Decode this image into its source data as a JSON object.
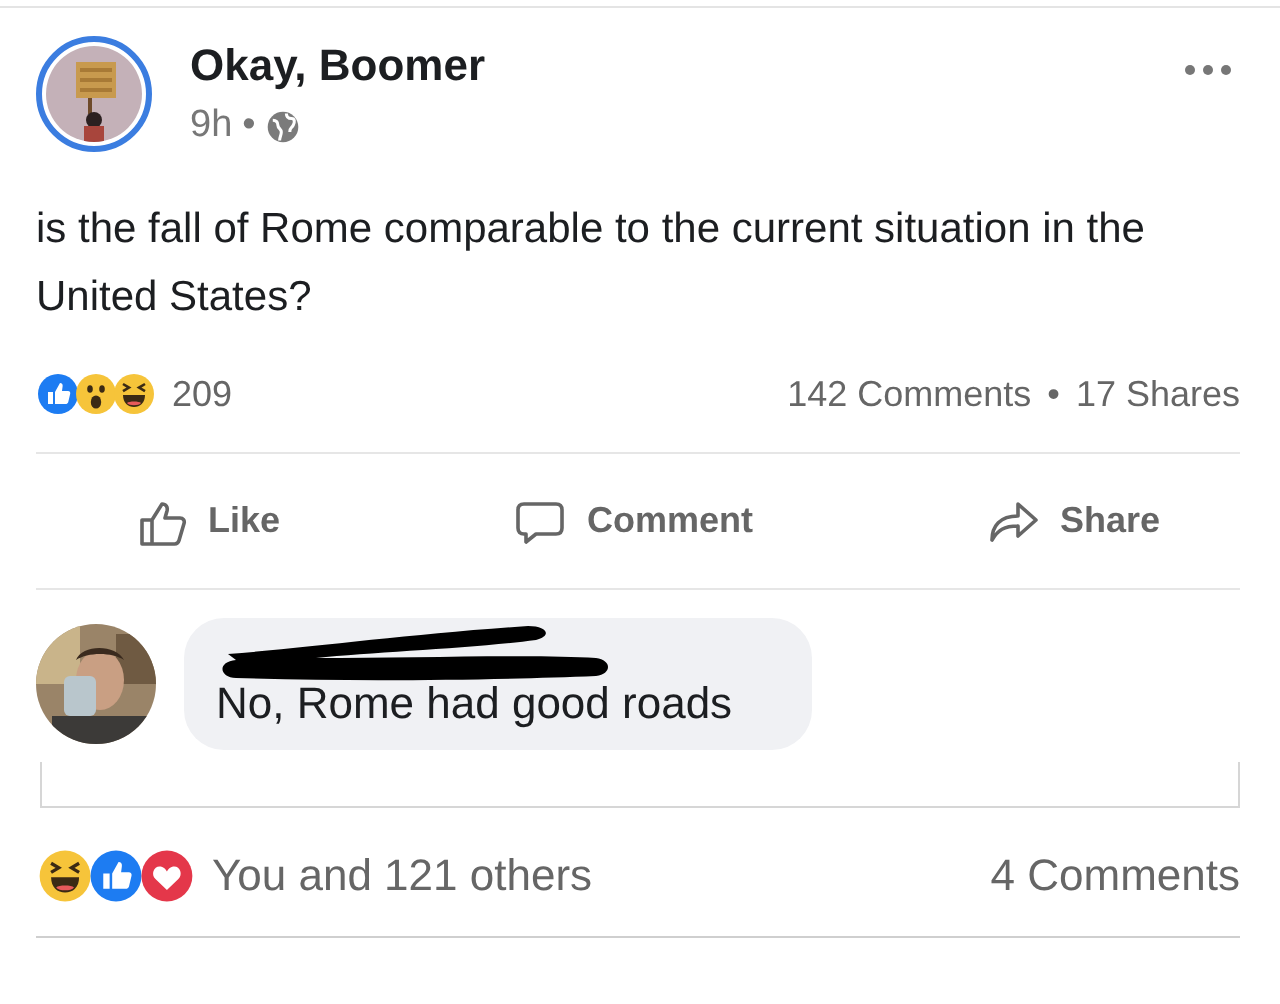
{
  "post": {
    "author": "Okay, Boomer",
    "time": "9h",
    "separator": "•",
    "text": "is the fall of Rome comparable to the current situation in the United States?",
    "reactions_count": "209",
    "comments_count": "142 Comments",
    "stats_separator": "•",
    "shares_count": "17 Shares"
  },
  "actions": [
    {
      "kind": "like",
      "label": "Like"
    },
    {
      "kind": "comment",
      "label": "Comment"
    },
    {
      "kind": "share",
      "label": "Share"
    }
  ],
  "comment": {
    "text": "No, Rome had good roads"
  },
  "footer": {
    "reactions_text": "You and 121 others",
    "comments_text": "4 Comments"
  }
}
